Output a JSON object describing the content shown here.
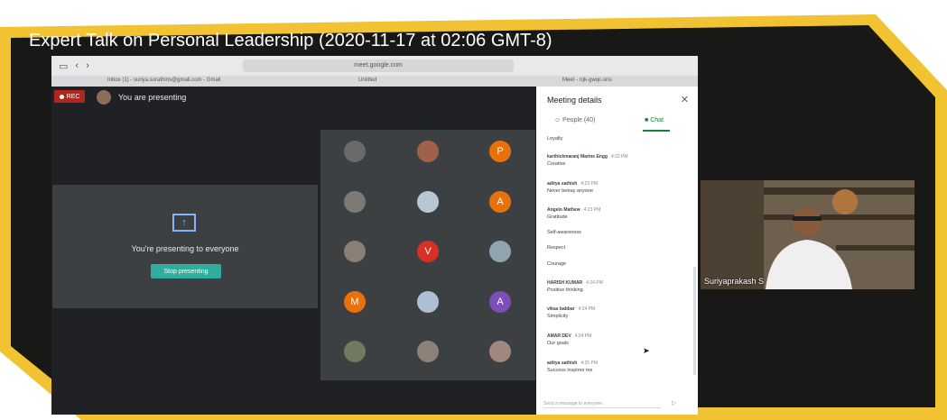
{
  "title": "Expert Talk on Personal Leadership (2020-11-17 at 02:06 GMT-8)",
  "browser": {
    "url": "meet.google.com",
    "tabs": [
      "Inbox (1) - suriya.surathins@gmail.com - Gmail",
      "Untitled",
      "Meet - rqk-gwqc-snu"
    ]
  },
  "stage": {
    "rec_label": "REC",
    "presenting_label": "You are presenting",
    "presenting_everyone": "You're presenting to everyone",
    "stop_button": "Stop presenting"
  },
  "grid": {
    "letters": [
      "P",
      "A",
      "V",
      "M",
      "A"
    ],
    "colors": {
      "orange": "#e8710a",
      "red": "#d93025",
      "purple": "#7b4eb8"
    }
  },
  "panel": {
    "title": "Meeting details",
    "people_tab": "People (40)",
    "chat_tab": "Chat",
    "send_placeholder": "Send a message to everyone"
  },
  "chat": [
    {
      "text": "Loyalty"
    },
    {
      "name": "karthickmaranj Marine Engg",
      "time": "4:22 PM",
      "text": "Creative"
    },
    {
      "name": "aditya sathish",
      "time": "4:23 PM",
      "text": "Never betray anyone"
    },
    {
      "name": "Angelo Mathew",
      "time": "4:23 PM",
      "text": "Gratitude"
    },
    {
      "text": "Self-awareness"
    },
    {
      "text": "Respect"
    },
    {
      "text": "Courage"
    },
    {
      "name": "HARISH KUMAR",
      "time": "4:24 PM",
      "text": "Positive thinking"
    },
    {
      "name": "vikas babbar",
      "time": "4:24 PM",
      "text": "Simplicity"
    },
    {
      "name": "AMAR DEV",
      "time": "4:24 PM",
      "text": "Our goals"
    },
    {
      "name": "aditya sathish",
      "time": "4:25 PM",
      "text": "Success inspires me"
    }
  ],
  "speaker": {
    "name": "Suriyaprakash S"
  },
  "colors": {
    "frame_gold": "#f1c232",
    "frame_dark": "#181816",
    "accent_teal": "#2fae9e"
  }
}
